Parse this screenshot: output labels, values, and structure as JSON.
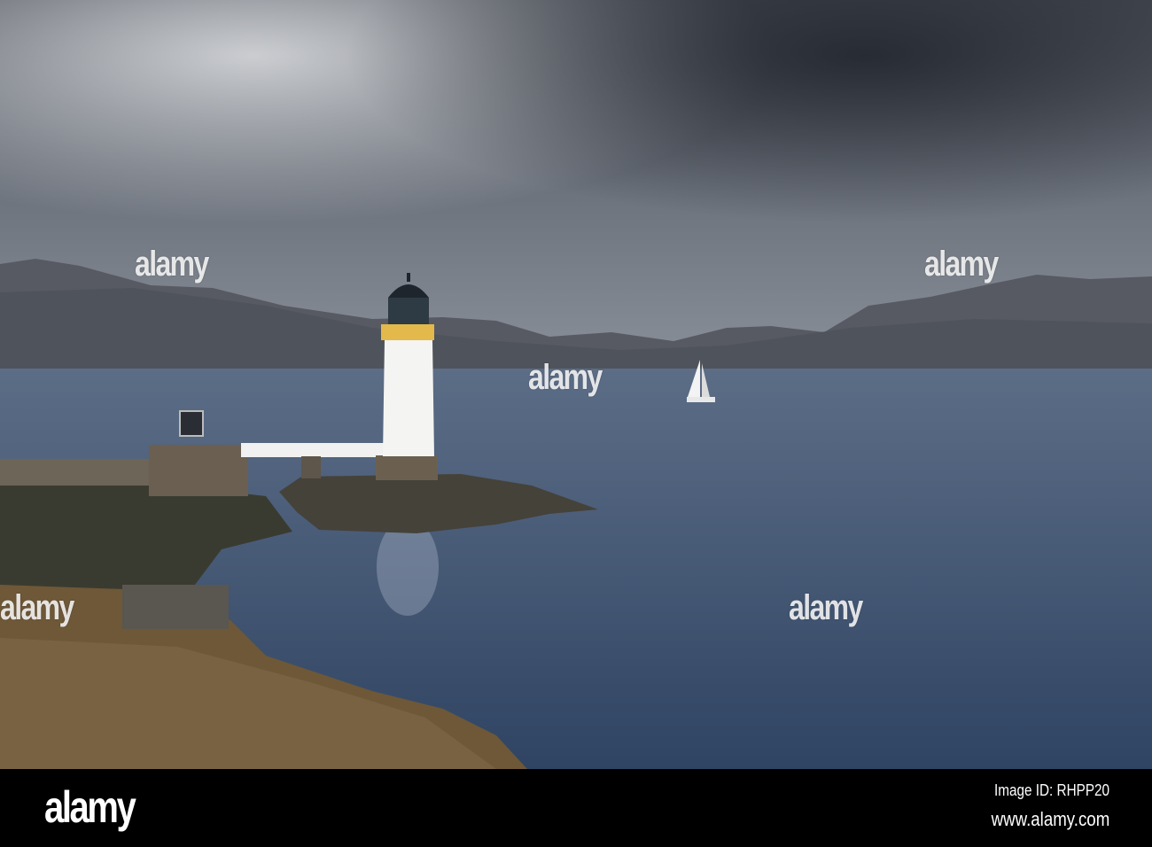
{
  "watermark": {
    "text": "alamy"
  },
  "footer": {
    "logo": "alamy",
    "image_id": "Image ID: RHPP20",
    "url": "www.alamy.com"
  }
}
